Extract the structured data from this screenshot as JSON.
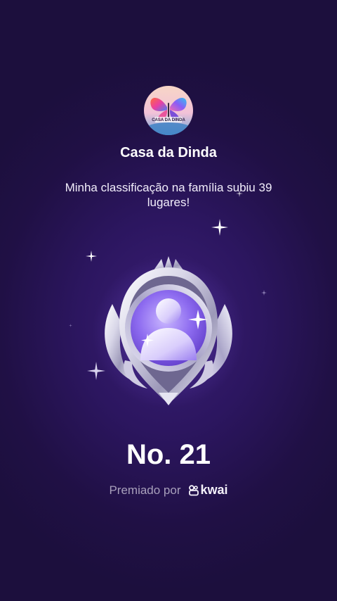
{
  "family": {
    "name": "Casa da Dinda",
    "avatar_text": "CASA DA DINDA"
  },
  "message": "Minha classificação na família subiu 39 lugares!",
  "rank": "No. 21",
  "awarded_by": {
    "label": "Premiado por",
    "brand": "kwai"
  },
  "colors": {
    "background": "#201045",
    "badge_accent": "#8e6cf0",
    "text_primary": "#ffffff",
    "text_muted": "#a8a0bb"
  }
}
